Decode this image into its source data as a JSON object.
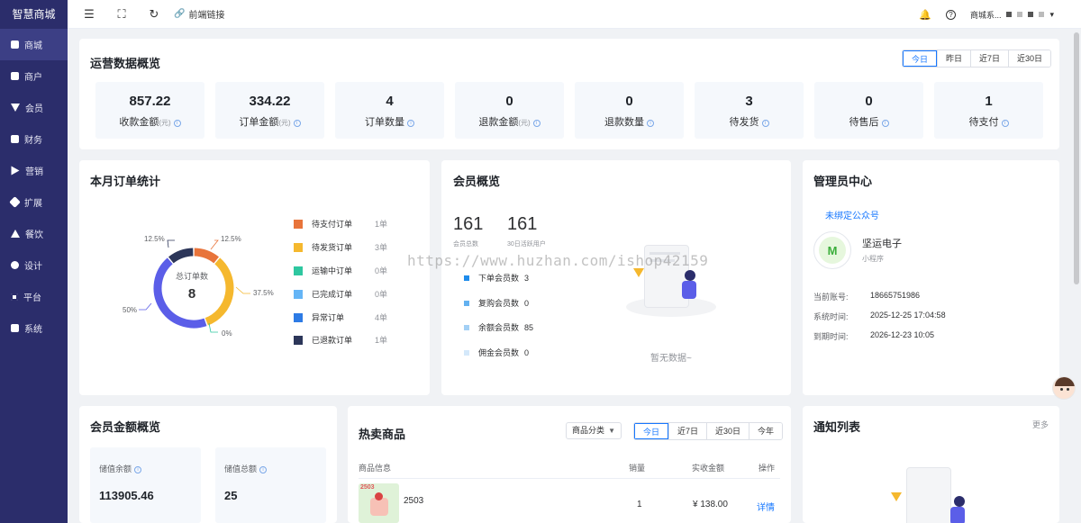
{
  "app": {
    "title": "智慧商城"
  },
  "sidebar": {
    "items": [
      {
        "label": "商城",
        "icon": "shop-icon"
      },
      {
        "label": "商户",
        "icon": "merchant-icon"
      },
      {
        "label": "会员",
        "icon": "member-icon"
      },
      {
        "label": "财务",
        "icon": "finance-icon"
      },
      {
        "label": "营销",
        "icon": "marketing-icon"
      },
      {
        "label": "扩展",
        "icon": "extension-icon"
      },
      {
        "label": "餐饮",
        "icon": "catering-icon"
      },
      {
        "label": "设计",
        "icon": "design-icon"
      },
      {
        "label": "平台",
        "icon": "platform-icon"
      },
      {
        "label": "系统",
        "icon": "system-icon"
      }
    ]
  },
  "topbar": {
    "frontend_link": "前端链接",
    "user_name": "商城系..."
  },
  "overview": {
    "title": "运营数据概览",
    "ranges": [
      "今日",
      "昨日",
      "近7日",
      "近30日"
    ],
    "stats": [
      {
        "value": "857.22",
        "label": "收款金额",
        "unit": "(元)"
      },
      {
        "value": "334.22",
        "label": "订单金额",
        "unit": "(元)"
      },
      {
        "value": "4",
        "label": "订单数量",
        "unit": ""
      },
      {
        "value": "0",
        "label": "退款金额",
        "unit": "(元)"
      },
      {
        "value": "0",
        "label": "退款数量",
        "unit": ""
      },
      {
        "value": "3",
        "label": "待发货",
        "unit": ""
      },
      {
        "value": "0",
        "label": "待售后",
        "unit": ""
      },
      {
        "value": "1",
        "label": "待支付",
        "unit": ""
      }
    ]
  },
  "orders": {
    "title": "本月订单统计",
    "center_label": "总订单数",
    "center_value": "8",
    "slice_labels": [
      "12.5%",
      "12.5%",
      "37.5%",
      "0%",
      "50%"
    ],
    "legend": [
      {
        "label": "待支付订单",
        "count": "1单",
        "color": "#e8743b"
      },
      {
        "label": "待发货订单",
        "count": "3单",
        "color": "#f5b82e"
      },
      {
        "label": "运输中订单",
        "count": "0单",
        "color": "#2ec7a0"
      },
      {
        "label": "已完成订单",
        "count": "0单",
        "color": "#65b5f6"
      },
      {
        "label": "异常订单",
        "count": "4单",
        "color": "#2d7be5"
      },
      {
        "label": "已退款订单",
        "count": "1单",
        "color": "#2c3659"
      }
    ]
  },
  "chart_data": {
    "type": "pie",
    "categories": [
      "待支付订单",
      "待发货订单",
      "运输中订单",
      "已完成订单",
      "异常订单",
      "已退款订单"
    ],
    "values": [
      1,
      3,
      0,
      0,
      4,
      1
    ],
    "title": "本月订单统计",
    "colors": [
      "#e8743b",
      "#f5b82e",
      "#2ec7a0",
      "#65b5f6",
      "#5b5ee8",
      "#2c3659"
    ]
  },
  "members": {
    "title": "会员概览",
    "total_value": "161",
    "total_label": "会员总数",
    "active_value": "161",
    "active_label": "30日活跃用户",
    "rows": [
      {
        "label": "下单会员数",
        "value": "3",
        "color": "#1f8ceb"
      },
      {
        "label": "复购会员数",
        "value": "0",
        "color": "#63b1f0"
      },
      {
        "label": "余额会员数",
        "value": "85",
        "color": "#a3d0f5"
      },
      {
        "label": "佣金会员数",
        "value": "0",
        "color": "#d4e8fa"
      }
    ],
    "empty_text": "暂无数据~"
  },
  "admin": {
    "title": "管理员中心",
    "unbind_link": "未绑定公众号",
    "company": "坚运电子",
    "company_sub": "小程序",
    "account_label": "当前账号:",
    "account_value": "18665751986",
    "time_label": "系统时间:",
    "time_value": "2025-12-25 17:04:58",
    "expire_label": "到期时间:",
    "expire_value": "2026-12-23 10:05"
  },
  "balance": {
    "title": "会员金额概览",
    "stored_label": "储值余额",
    "stored_value": "113905.46",
    "total_label": "储值总额",
    "total_value": "25"
  },
  "hot": {
    "title": "热卖商品",
    "category_select": "商品分类",
    "ranges": [
      "今日",
      "近7日",
      "近30日",
      "今年"
    ],
    "columns": [
      "商品信息",
      "销量",
      "实收金额",
      "操作"
    ],
    "rows": [
      {
        "thumb_tag": "2503",
        "name": "2503",
        "sales": "1",
        "amount": "¥ 138.00",
        "action": "详情"
      }
    ]
  },
  "notices": {
    "title": "通知列表",
    "more": "更多"
  },
  "watermark": "https://www.huzhan.com/ishop42159"
}
